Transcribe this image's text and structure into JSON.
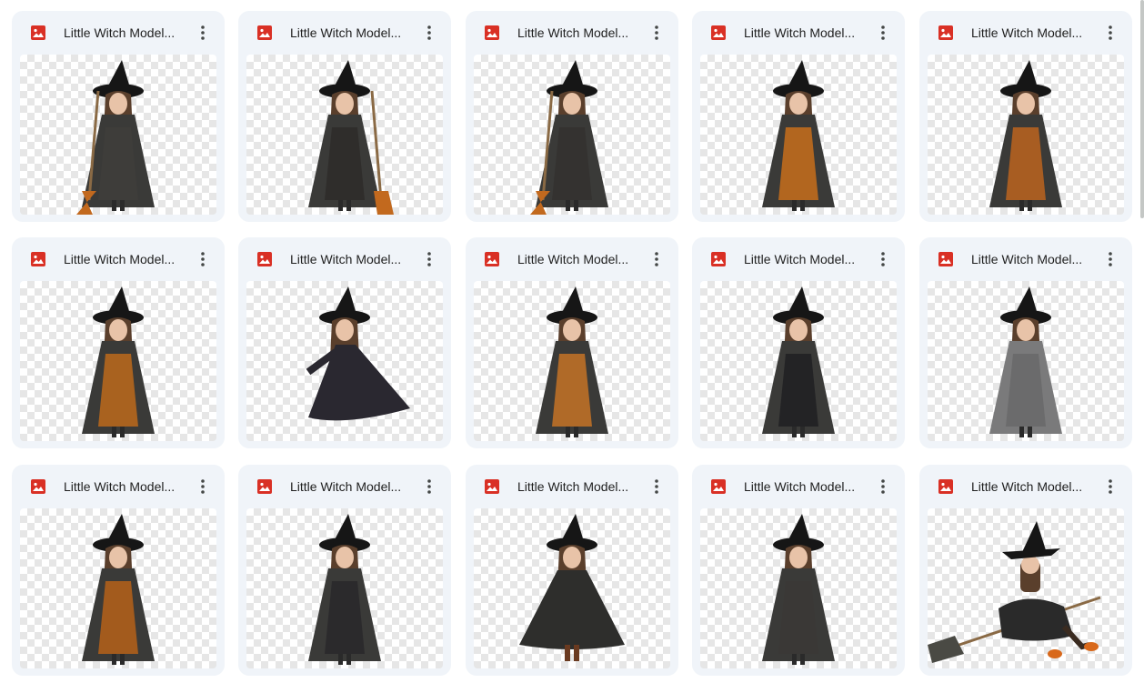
{
  "files": [
    {
      "name": "Little Witch Model...",
      "icon": "image-file-icon",
      "pose": "broom-left",
      "dress": "#3e3d3a"
    },
    {
      "name": "Little Witch Model...",
      "icon": "image-file-icon",
      "pose": "broom-right",
      "dress": "#2f2d2b"
    },
    {
      "name": "Little Witch Model...",
      "icon": "image-file-icon",
      "pose": "broom-left",
      "dress": "#343230"
    },
    {
      "name": "Little Witch Model...",
      "icon": "image-file-icon",
      "pose": "cape-orange",
      "dress": "#b2661f"
    },
    {
      "name": "Little Witch Model...",
      "icon": "image-file-icon",
      "pose": "cape-orange",
      "dress": "#a85d22"
    },
    {
      "name": "Little Witch Model...",
      "icon": "image-file-icon",
      "pose": "cape-orange",
      "dress": "#a9621f"
    },
    {
      "name": "Little Witch Model...",
      "icon": "image-file-icon",
      "pose": "twirl",
      "dress": "#2a2830"
    },
    {
      "name": "Little Witch Model...",
      "icon": "image-file-icon",
      "pose": "cape-orange",
      "dress": "#b06a28"
    },
    {
      "name": "Little Witch Model...",
      "icon": "image-file-icon",
      "pose": "cape-dark",
      "dress": "#232325"
    },
    {
      "name": "Little Witch Model...",
      "icon": "image-file-icon",
      "pose": "grey-dress",
      "dress": "#6b6b6c"
    },
    {
      "name": "Little Witch Model...",
      "icon": "image-file-icon",
      "pose": "cape-orange",
      "dress": "#a35b1d"
    },
    {
      "name": "Little Witch Model...",
      "icon": "image-file-icon",
      "pose": "cape-dark",
      "dress": "#2b2a2c"
    },
    {
      "name": "Little Witch Model...",
      "icon": "image-file-icon",
      "pose": "wide-cape",
      "dress": "#2e2e2c"
    },
    {
      "name": "Little Witch Model...",
      "icon": "image-file-icon",
      "pose": "cape-dark",
      "dress": "#3a3836"
    },
    {
      "name": "Little Witch Model...",
      "icon": "image-file-icon",
      "pose": "flying",
      "dress": "#2a2a2a"
    }
  ],
  "colors": {
    "card_bg": "#f0f4f9",
    "image_icon": "#d93025",
    "hat": "#161616",
    "skin": "#e8c3a8",
    "hair": "#5a3f2c",
    "broom_straw": "#c2691e",
    "broom_stick": "#8a6a45"
  }
}
